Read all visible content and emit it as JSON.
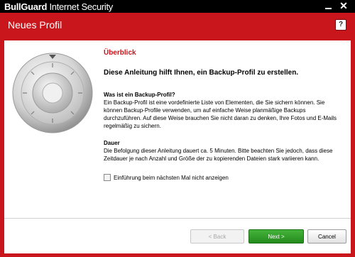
{
  "window": {
    "brand_bold": "BullGuard",
    "brand_light": " Internet Security",
    "minimize_glyph": "",
    "close_glyph": "✕"
  },
  "header": {
    "title": "Neues Profil",
    "help_label": "?"
  },
  "main": {
    "section_title": "Überblick",
    "headline": "Diese Anleitung hilft Ihnen, ein Backup-Profil zu erstellen.",
    "question_title": "Was ist ein Backup-Profil?",
    "question_body": "Ein Backup-Profil ist eine vordefinierte Liste von Elementen, die Sie sichern können. Sie können Backup-Profile verwenden, um auf einfache Weise planmäßige Backups durchzuführen. Auf diese Weise brauchen Sie nicht daran zu denken, Ihre Fotos und E-Mails regelmäßig zu sichern.",
    "duration_title": "Dauer",
    "duration_body": "Die Befolgung dieser Anleitung dauert ca. 5 Minuten. Bitte beachten Sie jedoch, dass diese Zeitdauer je nach Anzahl und Größe der zu kopierenden Dateien stark variieren kann.",
    "checkbox_label": "Einführung beim nächsten Mal nicht anzeigen",
    "checkbox_checked": false
  },
  "footer": {
    "back_label": "< Back",
    "next_label": "Next >",
    "cancel_label": "Cancel"
  },
  "colors": {
    "brand_red": "#c9151c",
    "next_green": "#2f9f27"
  },
  "icons": {
    "illustration": "safe-dial-icon",
    "close": "close-icon",
    "minimize": "minimize-icon",
    "help": "help-icon"
  }
}
